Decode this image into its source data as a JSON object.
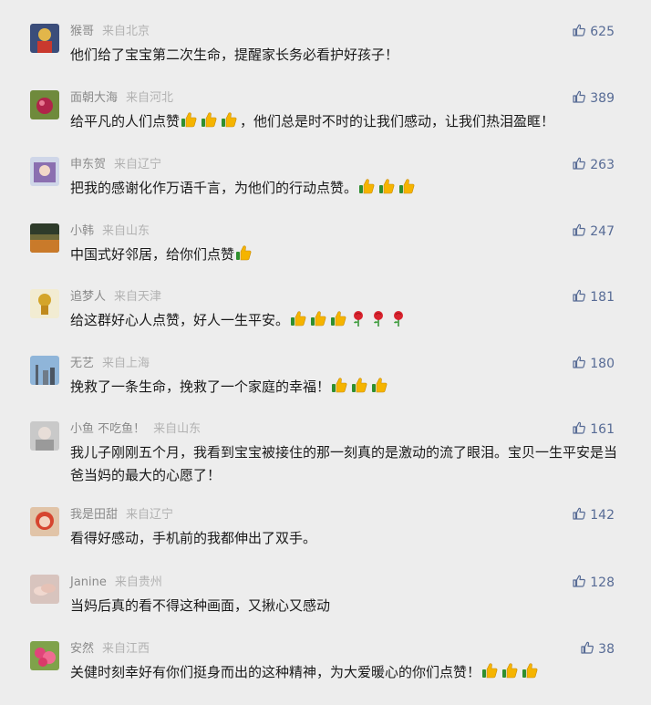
{
  "comments": [
    {
      "name": "猴哥",
      "location": "来自北京",
      "likes": "625",
      "text": "他们给了宝宝第二次生命，提醒家长务必看护好孩子！",
      "text2": "",
      "emojis": []
    },
    {
      "name": "面朝大海",
      "location": "来自河北",
      "likes": "389",
      "text": "给平凡的人们点赞",
      "text2": "，他们总是时不时的让我们感动，让我们热泪盈眶！",
      "emojis": [
        "thumbs-up-icon",
        "thumbs-up-icon",
        "thumbs-up-icon"
      ]
    },
    {
      "name": "申东贺",
      "location": "来自辽宁",
      "likes": "263",
      "text": "把我的感谢化作万语千言，为他们的行动点赞。",
      "text2": "",
      "emojis": [
        "thumbs-up-icon",
        "thumbs-up-icon",
        "thumbs-up-icon"
      ]
    },
    {
      "name": "小韩",
      "location": "来自山东",
      "likes": "247",
      "text": "中国式好邻居，给你们点赞",
      "text2": "",
      "emojis": [
        "thumbs-up-icon"
      ]
    },
    {
      "name": "追梦人",
      "location": "来自天津",
      "likes": "181",
      "text": "给这群好心人点赞，好人一生平安。",
      "text2": "",
      "emojis": [
        "thumbs-up-icon",
        "thumbs-up-icon",
        "thumbs-up-icon",
        "rose-icon",
        "rose-icon",
        "rose-icon"
      ]
    },
    {
      "name": "无艺",
      "location": "来自上海",
      "likes": "180",
      "text": "挽救了一条生命，挽救了一个家庭的幸福！",
      "text2": "",
      "emojis": [
        "thumbs-up-icon",
        "thumbs-up-icon",
        "thumbs-up-icon"
      ]
    },
    {
      "name": "小鱼 不吃鱼！",
      "location": "来自山东",
      "likes": "161",
      "text": "我儿子刚刚五个月，我看到宝宝被接住的那一刻真的是激动的流了眼泪。宝贝一生平安是当爸当妈的最大的心愿了！",
      "text2": "",
      "emojis": []
    },
    {
      "name": "我是田甜",
      "location": "来自辽宁",
      "likes": "142",
      "text": "看得好感动，手机前的我都伸出了双手。",
      "text2": "",
      "emojis": []
    },
    {
      "name": "Janine",
      "location": "来自贵州",
      "likes": "128",
      "text": "当妈后真的看不得这种画面，又揪心又感动",
      "text2": "",
      "emojis": []
    },
    {
      "name": "安然",
      "location": "来自江西",
      "likes": "38",
      "text": "关健时刻幸好有你们挺身而出的这种精神，为大爱暖心的你们点赞！",
      "text2": "",
      "emojis": [
        "thumbs-up-icon",
        "thumbs-up-icon",
        "thumbs-up-icon"
      ]
    }
  ],
  "colors": {
    "background": "#ededed",
    "nickname": "#8a8a8a",
    "location": "#b2b2b2",
    "likes": "#576b95",
    "text": "#1a1a1a"
  }
}
